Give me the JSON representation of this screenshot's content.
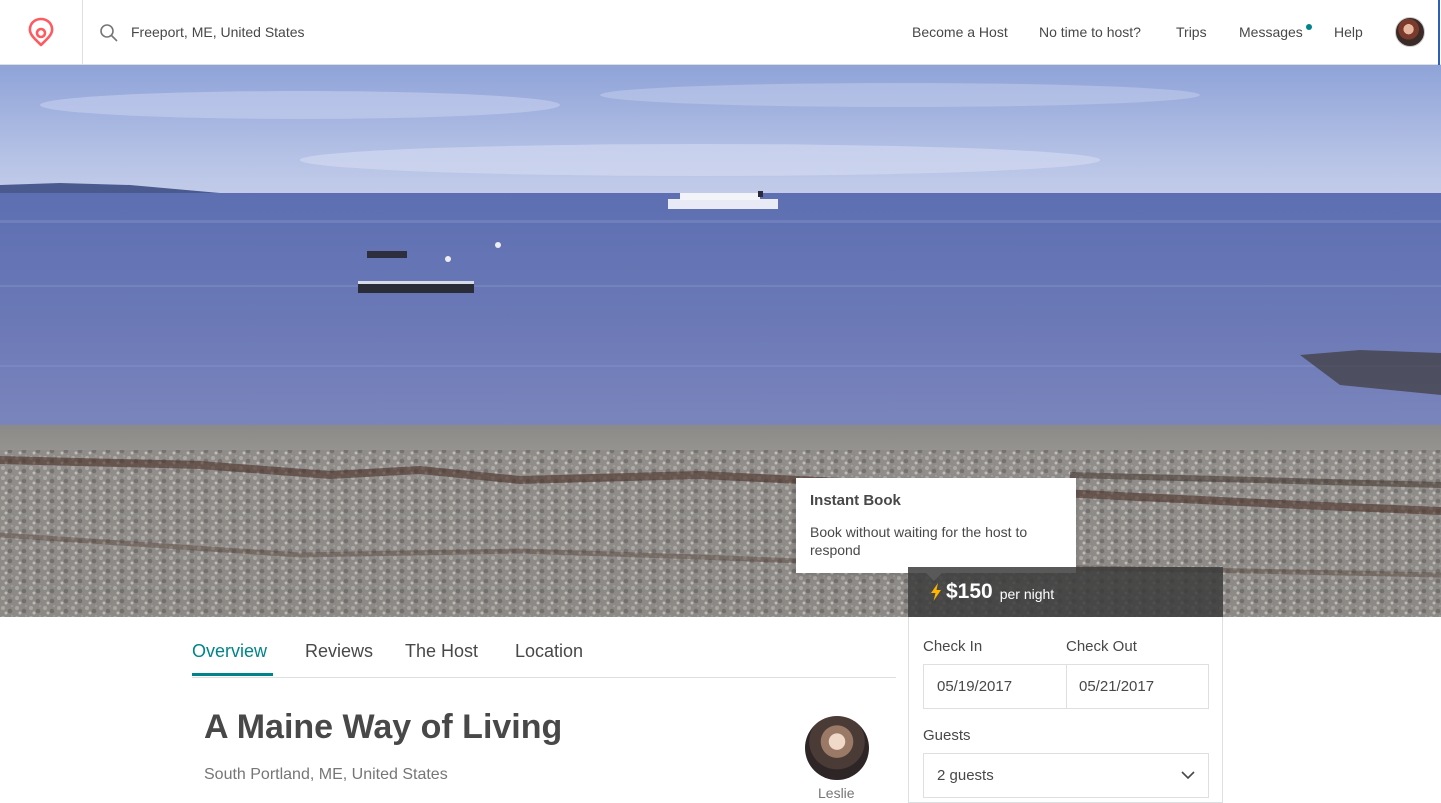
{
  "header": {
    "search_value": "Freeport, ME, United States",
    "nav": {
      "become_host": "Become a Host",
      "no_time": "No time to host?",
      "trips": "Trips",
      "messages": "Messages",
      "help": "Help"
    },
    "brand_color": "#FF5A5F"
  },
  "tooltip": {
    "title": "Instant Book",
    "body": "Book without waiting for the host to respond"
  },
  "price": {
    "amount": "$150",
    "per": "per night"
  },
  "booking": {
    "check_in_label": "Check In",
    "check_out_label": "Check Out",
    "check_in_value": "05/19/2017",
    "check_out_value": "05/21/2017",
    "guests_label": "Guests",
    "guests_value": "2 guests"
  },
  "tabs": [
    {
      "label": "Overview",
      "active": true
    },
    {
      "label": "Reviews"
    },
    {
      "label": "The Host"
    },
    {
      "label": "Location"
    }
  ],
  "listing": {
    "title": "A Maine Way of Living",
    "location": "South Portland, ME, United States",
    "host_name": "Leslie"
  },
  "colors": {
    "accent": "#008489",
    "bolt": "#FFB400"
  }
}
